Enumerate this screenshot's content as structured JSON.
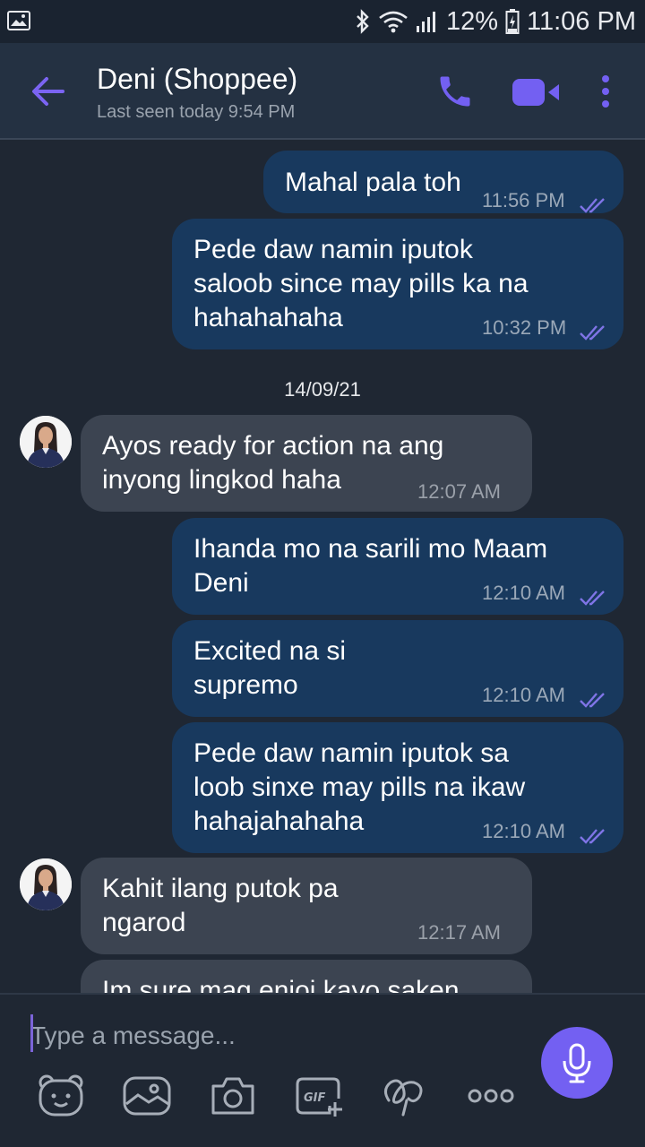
{
  "status_bar": {
    "battery": "12%",
    "time": "11:06 PM"
  },
  "header": {
    "contact_name": "Deni (Shoppee)",
    "last_seen": "Last seen today 9:54 PM",
    "accent_color": "#7360f2"
  },
  "messages": [
    {
      "dir": "out",
      "text": "Mahal pala toh",
      "time": "11:56 PM"
    },
    {
      "dir": "out",
      "text": "Pede daw namin iputok\nsaloob since may pills ka na\nhahahahaha",
      "time": "10:32 PM"
    },
    {
      "dir": "out",
      "text": "Ihanda mo na sarili mo Maam\nDeni",
      "time": "12:10 AM"
    },
    {
      "dir": "out",
      "text": "Excited na si\nsupremo",
      "time": "12:10 AM"
    },
    {
      "dir": "out",
      "text": "Pede daw namin iputok sa\nloob sinxe may pills na ikaw\nhahajahahaha",
      "time": "12:10 AM"
    }
  ],
  "date_separator": "14/09/21",
  "incoming": [
    {
      "text": "Ayos ready for action na ang\ninyong lingkod haha",
      "time": "12:07 AM"
    },
    {
      "text": "Kahit ilang putok pa\nngarod",
      "time": "12:17 AM"
    },
    {
      "text": "Im sure mag enjoi kayo saken"
    }
  ],
  "composer": {
    "placeholder": "Type a message...",
    "tools": [
      "sticker-icon",
      "image-icon",
      "camera-icon",
      "gif-icon",
      "doodle-icon",
      "more-icon"
    ]
  }
}
